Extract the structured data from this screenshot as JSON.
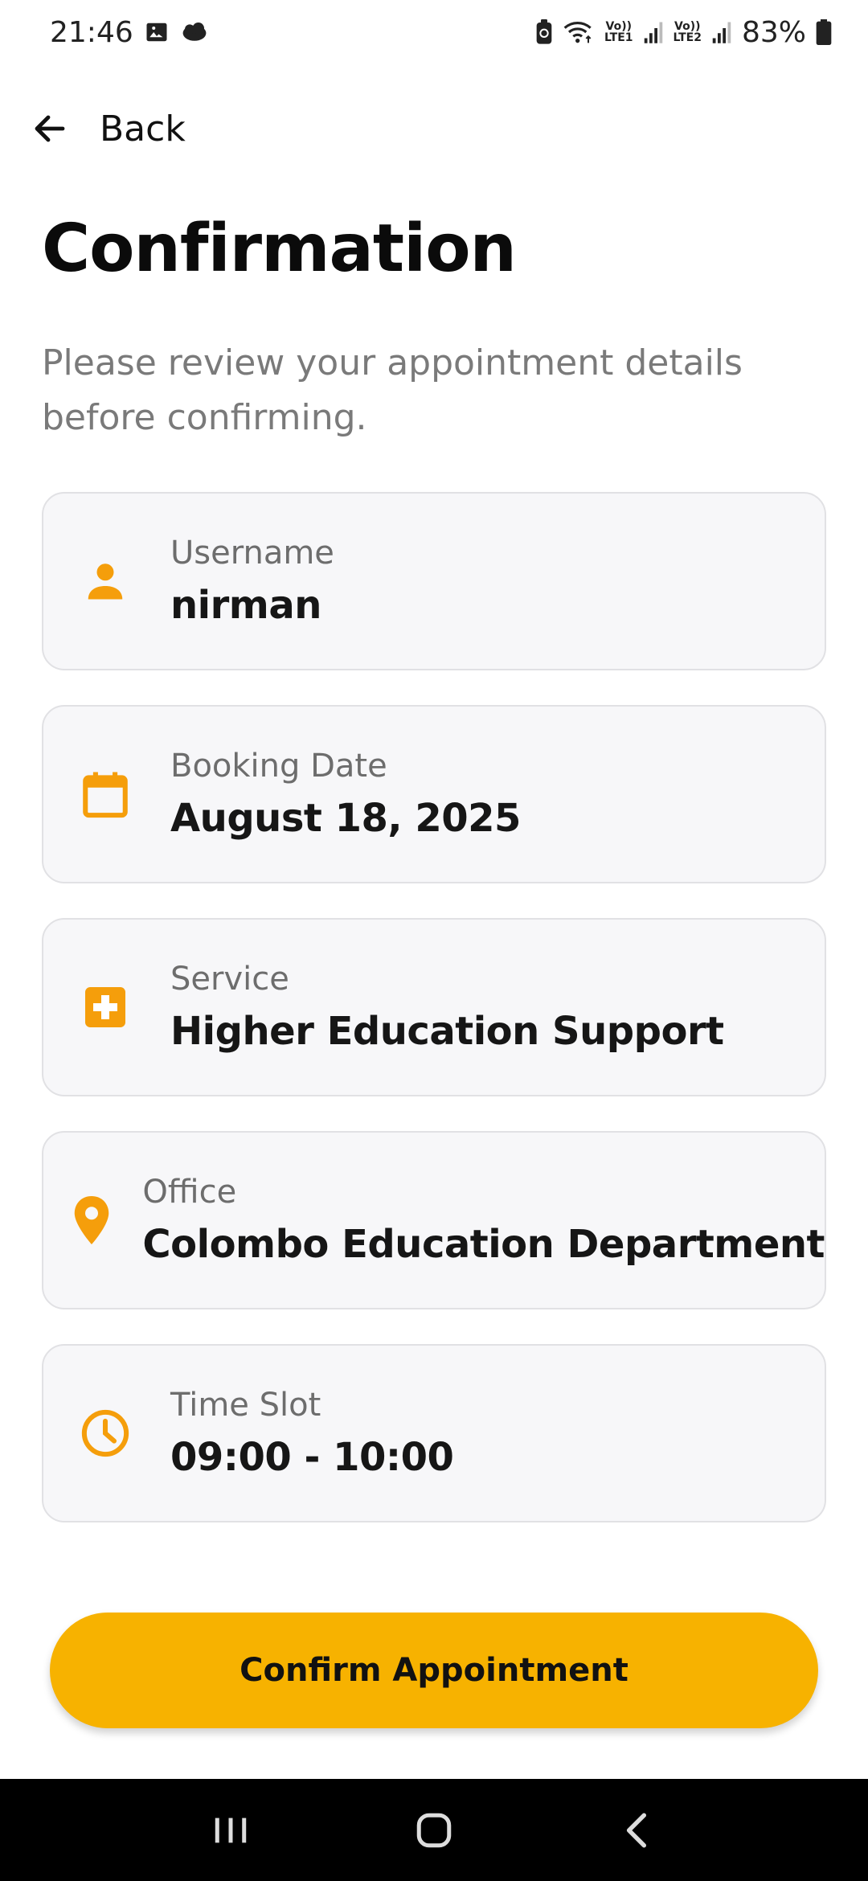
{
  "status_bar": {
    "time": "21:46",
    "battery": "83%",
    "icons": [
      "gallery-icon",
      "weather-icon",
      "battery-saver-icon",
      "wifi-icon",
      "volte-lte1-icon",
      "signal-icon",
      "volte-lte2-icon",
      "signal-icon",
      "battery-icon"
    ],
    "lte1": "LTE1",
    "lte2": "LTE2",
    "volte": "Vo))"
  },
  "header": {
    "back_label": "Back"
  },
  "page": {
    "title": "Confirmation",
    "subtitle": "Please review your appointment details before confirming."
  },
  "details": [
    {
      "label": "Username",
      "value": "nirman",
      "icon": "person-icon"
    },
    {
      "label": "Booking Date",
      "value": "August 18, 2025",
      "icon": "calendar-icon"
    },
    {
      "label": "Service",
      "value": "Higher Education Support",
      "icon": "medical-cross-icon"
    },
    {
      "label": "Office",
      "value": "Colombo Education Department",
      "icon": "location-pin-icon"
    },
    {
      "label": "Time Slot",
      "value": "09:00 - 10:00",
      "icon": "clock-icon"
    }
  ],
  "actions": {
    "confirm_label": "Confirm Appointment"
  },
  "colors": {
    "accent": "#f7b200",
    "icon": "#f59e0b",
    "card_bg": "#f7f7f9",
    "card_border": "#e1e1e4",
    "navbar_bg": "#000000"
  },
  "nav_bar": {
    "buttons": [
      "recents-icon",
      "home-icon",
      "back-nav-icon"
    ]
  }
}
